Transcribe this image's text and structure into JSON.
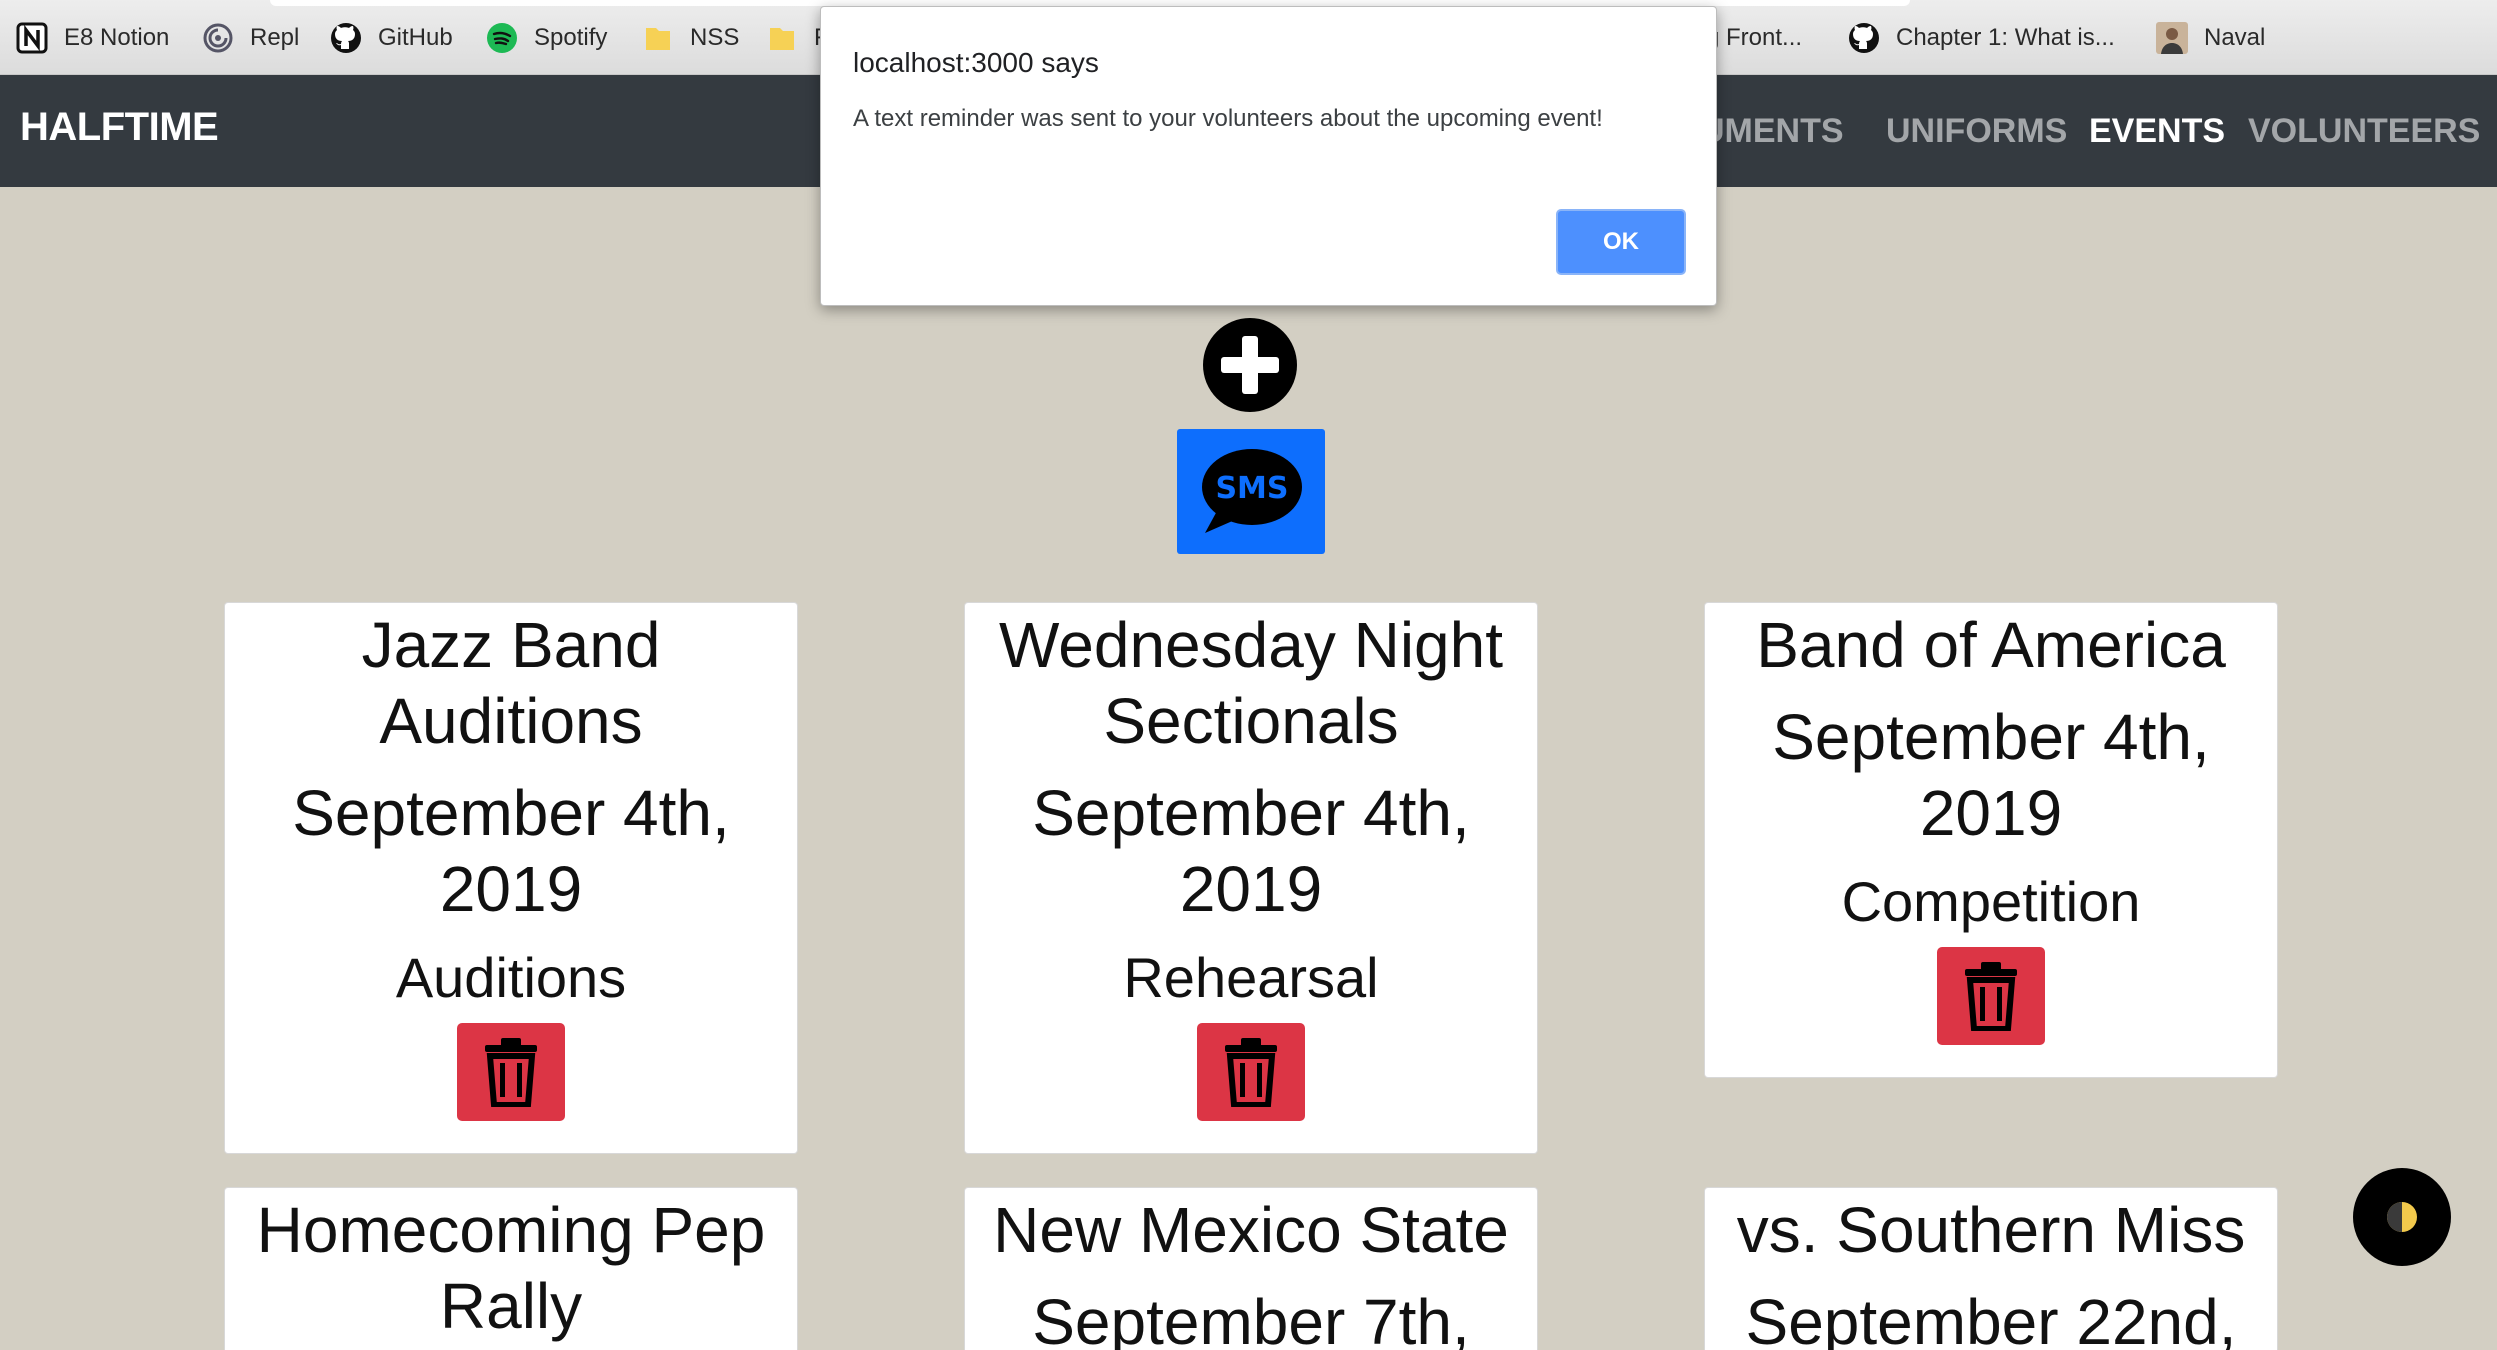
{
  "bookmarks": [
    {
      "label": "E8 Notion",
      "icon": "notion-icon"
    },
    {
      "label": "Repl",
      "icon": "repl-icon"
    },
    {
      "label": "GitHub",
      "icon": "github-icon"
    },
    {
      "label": "Spotify",
      "icon": "spotify-icon"
    },
    {
      "label": "NSS",
      "icon": "folder-icon"
    },
    {
      "label": "F",
      "icon": "folder-icon"
    },
    {
      "label": "g Front...",
      "icon": ""
    },
    {
      "label": "Chapter 1: What is...",
      "icon": "github-icon"
    },
    {
      "label": "Naval",
      "icon": "avatar-icon"
    }
  ],
  "navbar": {
    "brand": "HALFTIME",
    "links": [
      "UMENTS",
      "UNIFORMS",
      "EVENTS",
      "VOLUNTEERS"
    ],
    "active": "EVENTS"
  },
  "actions": {
    "sms_label": "SMS"
  },
  "events": [
    {
      "title_lines": [
        "Jazz Band",
        "Auditions"
      ],
      "date_lines": [
        "September 4th,",
        "2019"
      ],
      "type": "Auditions"
    },
    {
      "title_lines": [
        "Wednesday Night",
        "Sectionals"
      ],
      "date_lines": [
        "September 4th,",
        "2019"
      ],
      "type": "Rehearsal"
    },
    {
      "title_lines": [
        "Band of America"
      ],
      "date_lines": [
        "September 4th,",
        "2019"
      ],
      "type": "Competition"
    },
    {
      "title_lines": [
        "Homecoming Pep",
        "Rally"
      ],
      "date_lines": [],
      "type": ""
    },
    {
      "title_lines": [
        "New Mexico State"
      ],
      "date_lines": [
        "September 7th,"
      ],
      "type": ""
    },
    {
      "title_lines": [
        "vs. Southern Miss"
      ],
      "date_lines": [
        "September 22nd,"
      ],
      "type": ""
    }
  ],
  "dialog": {
    "title": "localhost:3000 says",
    "message": "A text reminder was sent to your volunteers about the upcoming event!",
    "ok_label": "OK"
  },
  "colors": {
    "background": "#d3cfc3",
    "navbar": "#343a40",
    "sms_button": "#0d6efd",
    "delete_button": "#dc3545",
    "dialog_ok": "#4d90fe"
  }
}
